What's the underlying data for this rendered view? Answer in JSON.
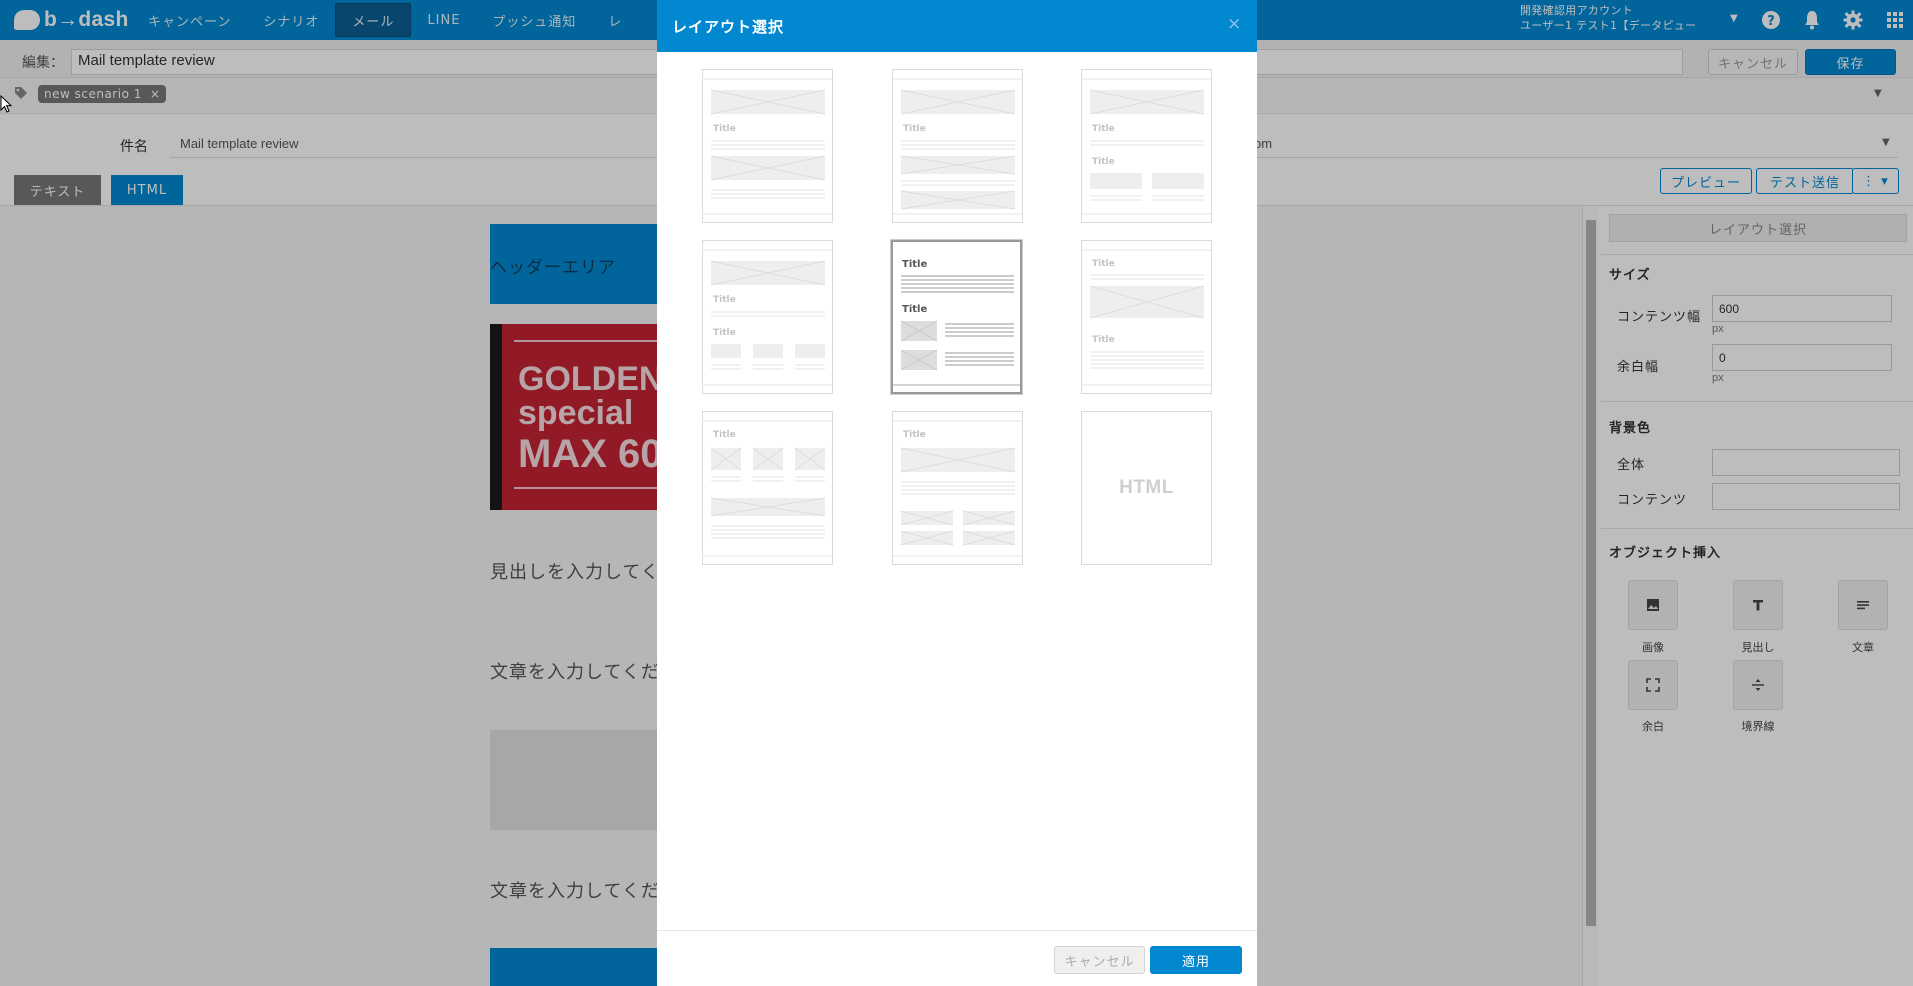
{
  "app": {
    "brand": "b→dash"
  },
  "nav": {
    "items": [
      "キャンペーン",
      "シナリオ",
      "メール",
      "LINE",
      "プッシュ通知",
      "レ"
    ],
    "active_index": 2
  },
  "account": {
    "line1": "開発確認用アカウント",
    "line2": "ユーザー1 テスト1【データピュー"
  },
  "editbar": {
    "label": "編集：",
    "name_value": "Mail template review",
    "cancel_label": "キャンセル",
    "save_label": "保存"
  },
  "tags": {
    "chip_label": "new scenario 1",
    "chip_remove": "×"
  },
  "subject": {
    "label": "件名",
    "value": "Mail template review",
    "from_suffix": "om"
  },
  "tabs": {
    "text": "テキスト",
    "html": "HTML"
  },
  "actions": {
    "preview": "プレビュー",
    "test_send": "テスト送信",
    "more": "⋮ ▾"
  },
  "canvas": {
    "header_area": "ヘッダーエリア",
    "banner_lines": [
      "GOLDEN",
      "special",
      "MAX 60"
    ],
    "heading_placeholder": "見出しを入力してください",
    "body_placeholder_1": "文章を入力してください",
    "body_placeholder_2": "文章を入力してください"
  },
  "panel": {
    "layout_select": "レイアウト選択",
    "size_title": "サイズ",
    "content_width_label": "コンテンツ幅",
    "content_width_value": "600",
    "margin_width_label": "余白幅",
    "margin_width_value": "0",
    "unit": "px",
    "bg_title": "背景色",
    "bg_all_label": "全体",
    "bg_content_label": "コンテンツ",
    "insert_title": "オブジェクト挿入",
    "objects": [
      {
        "label": "画像",
        "icon": "image-icon"
      },
      {
        "label": "見出し",
        "icon": "heading-icon"
      },
      {
        "label": "文章",
        "icon": "text-icon"
      },
      {
        "label": "余白",
        "icon": "spacer-icon"
      },
      {
        "label": "境界線",
        "icon": "divider-icon"
      }
    ]
  },
  "modal": {
    "title": "レイアウト選択",
    "close": "×",
    "template_title": "Title",
    "html_template_label": "HTML",
    "selected_index": 4,
    "cancel_label": "キャンセル",
    "apply_label": "適用"
  },
  "colors": {
    "brand": "#0288d1",
    "nav_active": "#0b5f94",
    "banner_red": "#c62434"
  }
}
